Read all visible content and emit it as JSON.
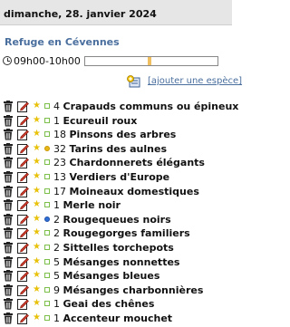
{
  "header": {
    "date": "dimanche, 28. janvier 2024"
  },
  "site": {
    "title": "Refuge en Cévennes"
  },
  "time": {
    "range": "09h00-10h00",
    "bar_fill_start": 0.47,
    "bar_fill_end": 0.5
  },
  "actions": {
    "add_species": "[ajouter une espèce]"
  },
  "colors": {
    "accent": "#4a6f9e",
    "star": "#e8c20a",
    "time_fill": "#f0c060"
  },
  "observations": [
    {
      "count": "4",
      "species": "Crapauds communs ou épineux",
      "marker": "square"
    },
    {
      "count": "1",
      "species": "Ecureuil roux",
      "marker": "square"
    },
    {
      "count": "18",
      "species": "Pinsons des arbres",
      "marker": "square"
    },
    {
      "count": "32",
      "species": "Tarins des aulnes",
      "marker": "yellow"
    },
    {
      "count": "23",
      "species": "Chardonnerets élégants",
      "marker": "square"
    },
    {
      "count": "13",
      "species": "Verdiers d'Europe",
      "marker": "square"
    },
    {
      "count": "17",
      "species": "Moineaux domestiques",
      "marker": "square"
    },
    {
      "count": "1",
      "species": "Merle noir",
      "marker": "square"
    },
    {
      "count": "2",
      "species": "Rougequeues noirs",
      "marker": "blue"
    },
    {
      "count": "2",
      "species": "Rougegorges familiers",
      "marker": "square"
    },
    {
      "count": "2",
      "species": "Sittelles torchepots",
      "marker": "square"
    },
    {
      "count": "5",
      "species": "Mésanges nonnettes",
      "marker": "square"
    },
    {
      "count": "5",
      "species": "Mésanges bleues",
      "marker": "square"
    },
    {
      "count": "9",
      "species": "Mésanges charbonnières",
      "marker": "square"
    },
    {
      "count": "1",
      "species": "Geai des chênes",
      "marker": "square"
    },
    {
      "count": "1",
      "species": "Accenteur mouchet",
      "marker": "square"
    }
  ]
}
